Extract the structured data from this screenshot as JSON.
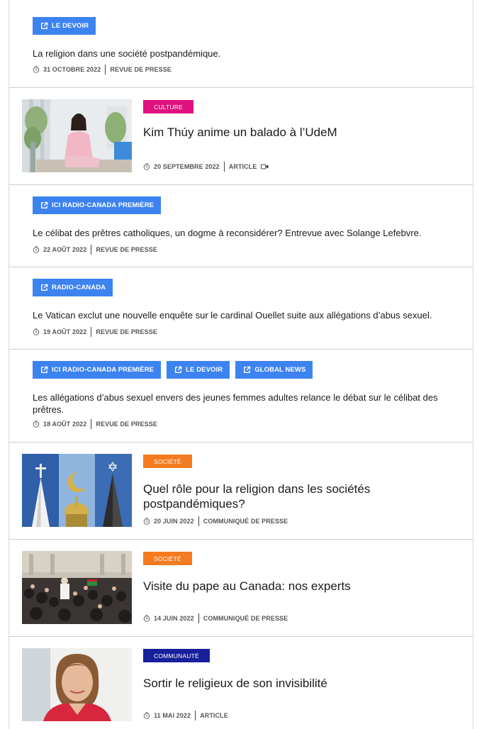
{
  "items": [
    {
      "kind": "press",
      "tags": [
        "LE DEVOIR"
      ],
      "title": "La religion dans une société postpandémique.",
      "date": "31 OCTOBRE 2022",
      "type": "REVUE DE PRESSE"
    },
    {
      "kind": "article",
      "category": "CULTURE",
      "category_color": "#e0117f",
      "title": "Kim Thúy anime un balado à l’UdeM",
      "date": "20 SEPTEMBRE 2022",
      "type": "ARTICLE",
      "has_video": true,
      "image": "kim-thuy-photo"
    },
    {
      "kind": "press",
      "tags": [
        "ICI RADIO-CANADA PREMIÈRE"
      ],
      "title": "Le célibat des prêtres catholiques, un dogme à reconsidérer? Entrevue avec Solange Lefebvre.",
      "date": "22 AOÛT 2022",
      "type": "REVUE DE PRESSE"
    },
    {
      "kind": "press",
      "tags": [
        "RADIO-CANADA"
      ],
      "title": "Le Vatican exclut une nouvelle enquête sur le cardinal Ouellet suite aux allégations d’abus sexuel.",
      "date": "19 AOÛT 2022",
      "type": "REVUE DE PRESSE"
    },
    {
      "kind": "press",
      "tags": [
        "ICI RADIO-CANADA PREMIÈRE",
        "LE DEVOIR",
        "GLOBAL NEWS"
      ],
      "title": "Les allégations d’abus sexuel envers des jeunes femmes adultes relance le débat sur le célibat des prêtres.",
      "date": "18 AOÛT 2022",
      "type": "REVUE DE PRESSE"
    },
    {
      "kind": "article",
      "category": "SOCIÉTÉ",
      "category_color": "#f47b20",
      "title": "Quel rôle pour la religion dans les sociétés postpandémiques?",
      "date": "20 JUIN 2022",
      "type": "COMMUNIQUÉ DE PRESSE",
      "has_video": false,
      "image": "religious-symbols-photo"
    },
    {
      "kind": "article",
      "category": "SOCIÉTÉ",
      "category_color": "#f47b20",
      "title": "Visite du pape au Canada: nos experts",
      "date": "14 JUIN 2022",
      "type": "COMMUNIQUÉ DE PRESSE",
      "has_video": false,
      "image": "pope-crowd-photo"
    },
    {
      "kind": "article",
      "category": "COMMUNAUTÉ",
      "category_color": "#17209a",
      "title": "Sortir le religieux de son invisibilité",
      "date": "11 MAI 2022",
      "type": "ARTICLE",
      "has_video": false,
      "image": "portrait-photo"
    }
  ]
}
